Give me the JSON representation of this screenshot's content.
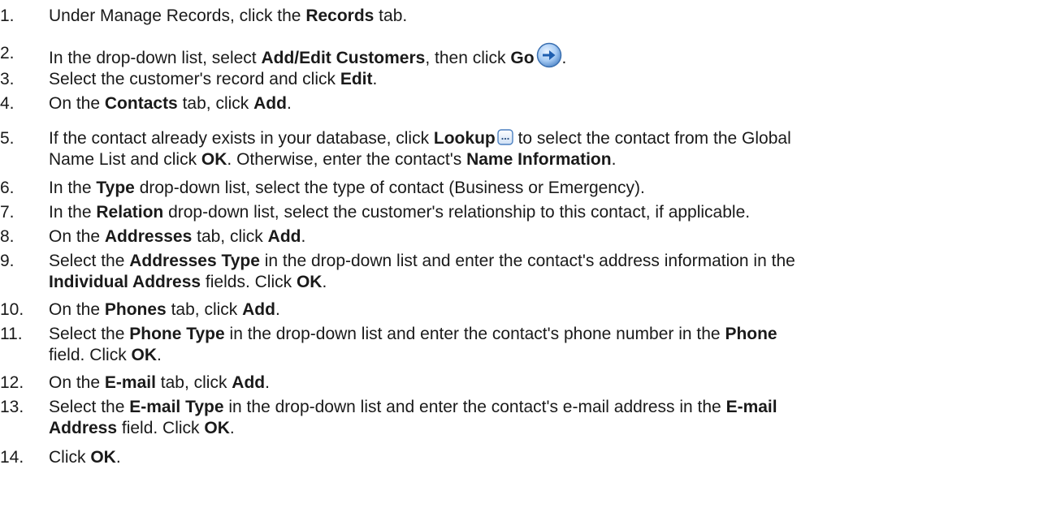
{
  "steps": [
    {
      "num": "1.",
      "parts": [
        "Under Manage Records, click the ",
        "Records",
        " tab."
      ]
    },
    {
      "num": "2.",
      "parts": [
        "In the drop-down list, select ",
        "Add/Edit Customers",
        ", then click ",
        "Go",
        "."
      ]
    },
    {
      "num": "3.",
      "parts": [
        "Select the customer's record and click ",
        "Edit",
        "."
      ]
    },
    {
      "num": "4.",
      "parts": [
        "On the ",
        "Contacts",
        " tab, click ",
        "Add",
        "."
      ]
    },
    {
      "num": "5.",
      "parts": [
        "If the contact already exists in your database, click ",
        "Lookup",
        " to select the contact from the Global",
        "Name List and click ",
        "OK",
        ". Otherwise, enter the contact's ",
        "Name Information",
        "."
      ]
    },
    {
      "num": "6.",
      "parts": [
        "In the ",
        "Type",
        " drop-down list, select the type of contact (Business or Emergency)."
      ]
    },
    {
      "num": "7.",
      "parts": [
        "In the ",
        "Relation",
        " drop-down list, select the customer's relationship to this contact, if applicable."
      ]
    },
    {
      "num": "8.",
      "parts": [
        "On the ",
        "Addresses",
        " tab, click ",
        "Add",
        "."
      ]
    },
    {
      "num": "9.",
      "parts": [
        "Select the ",
        "Addresses Type",
        " in the drop-down list and enter the contact's address information in the",
        "Individual Address",
        " fields. Click ",
        "OK",
        "."
      ]
    },
    {
      "num": "10.",
      "parts": [
        "On the ",
        "Phones",
        " tab, click ",
        "Add",
        "."
      ]
    },
    {
      "num": "11.",
      "parts": [
        "Select the ",
        "Phone Type",
        " in the drop-down list and enter the contact's phone number in the ",
        "Phone",
        "field. Click ",
        "OK",
        "."
      ]
    },
    {
      "num": "12.",
      "parts": [
        "On the ",
        "E-mail",
        " tab, click ",
        "Add",
        "."
      ]
    },
    {
      "num": "13.",
      "parts": [
        "Select the ",
        "E-mail Type",
        " in the drop-down list and enter the contact's e-mail address in the ",
        "E-mail",
        "Address",
        " field. Click ",
        "OK",
        "."
      ]
    },
    {
      "num": "14.",
      "parts": [
        "Click ",
        "OK",
        "."
      ]
    }
  ],
  "icons": {
    "go": "go-arrow-icon",
    "lookup": "lookup-ellipsis-icon",
    "go_color": "#3a7fd0",
    "lookup_color": "#4a7fc0"
  }
}
